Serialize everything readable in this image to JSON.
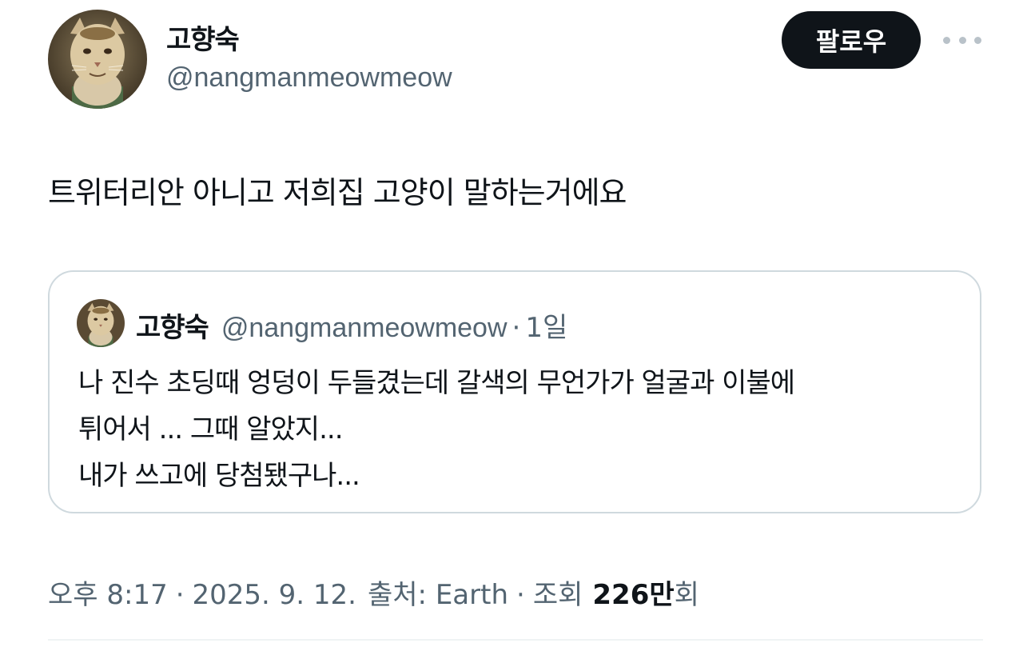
{
  "tweet": {
    "author": {
      "display_name": "고향숙",
      "handle": "@nangmanmeowmeow",
      "avatar": "cat-avatar"
    },
    "follow_label": "팔로우",
    "more_icon": "more-horizontal-icon",
    "text": "트위터리안 아니고 저희집 고양이 말하는거에요",
    "quote": {
      "display_name": "고향숙",
      "handle": "@nangmanmeowmeow",
      "separator": "·",
      "time": "1일",
      "lines": [
        "나 진수 초딩때 엉덩이 두들겼는데 갈색의 무언가가 얼굴과 이불에",
        "튀어서 ... 그때 알았지...",
        "내가 쓰고에 당첨됐구나..."
      ]
    },
    "meta": {
      "time": "오후 8:17",
      "date": "2025. 9. 12.",
      "source_label": "출처: Earth",
      "views_label": "조회",
      "views_count": "226만",
      "views_suffix": "회",
      "separator": "·"
    }
  },
  "colors": {
    "text_primary": "#0f1419",
    "text_secondary": "#536471",
    "border": "#cfd9de",
    "button_bg": "#0f1419"
  }
}
